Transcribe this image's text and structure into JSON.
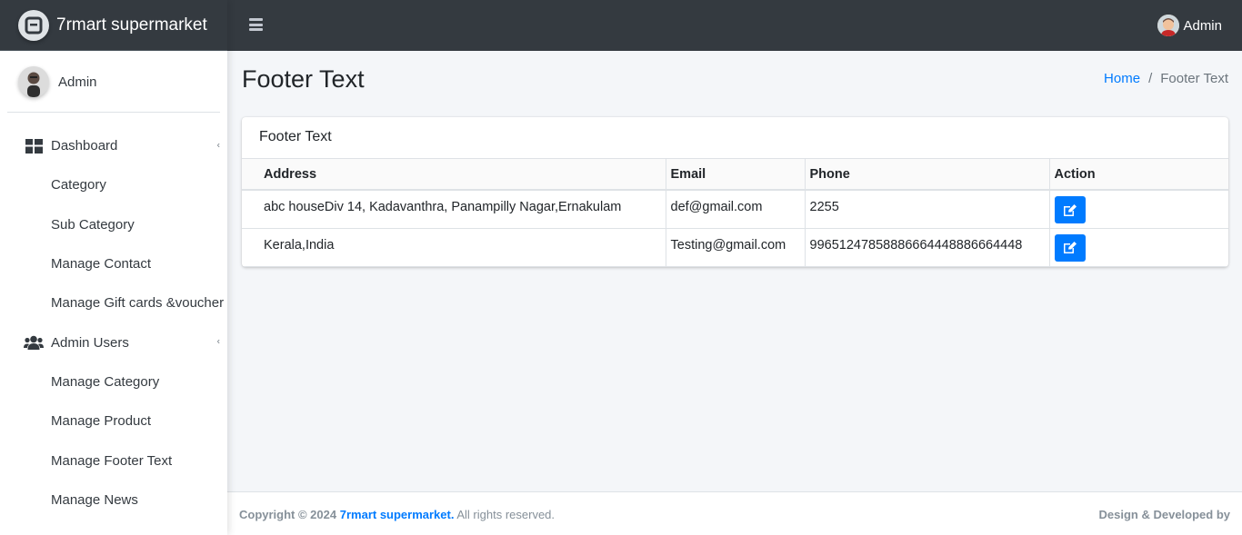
{
  "brand": {
    "name": "7rmart supermarket"
  },
  "sidebar": {
    "user_name": "Admin",
    "items": [
      {
        "label": "Dashboard",
        "icon": "dashboard-grid-icon",
        "expandable": true
      },
      {
        "label": "Category"
      },
      {
        "label": "Sub Category"
      },
      {
        "label": "Manage Contact"
      },
      {
        "label": "Manage Gift cards &voucher"
      },
      {
        "label": "Admin Users",
        "icon": "users-icon",
        "expandable": true
      },
      {
        "label": "Manage Category"
      },
      {
        "label": "Manage Product"
      },
      {
        "label": "Manage Footer Text"
      },
      {
        "label": "Manage News"
      }
    ]
  },
  "navbar": {
    "user_name": "Admin"
  },
  "page": {
    "title": "Footer Text",
    "breadcrumb": {
      "home": "Home",
      "separator": "/",
      "current": "Footer Text"
    }
  },
  "card": {
    "header": "Footer Text",
    "columns": [
      "Address",
      "Email",
      "Phone",
      "Action"
    ],
    "rows": [
      {
        "address": "abc houseDiv 14, Kadavanthra, Panampilly Nagar,Ernakulam",
        "email": "def@gmail.com",
        "phone": "2255"
      },
      {
        "address": "Kerala,India",
        "email": "Testing@gmail.com",
        "phone": "99651247858886664448886664448"
      }
    ]
  },
  "footer": {
    "copyright": "Copyright © 2024",
    "brand_link": "7rmart supermarket.",
    "rights": "All rights reserved.",
    "right_text": "Design & Developed by"
  },
  "colors": {
    "navbar_bg": "#343a40",
    "primary": "#007bff",
    "content_bg": "#f4f6f9"
  }
}
